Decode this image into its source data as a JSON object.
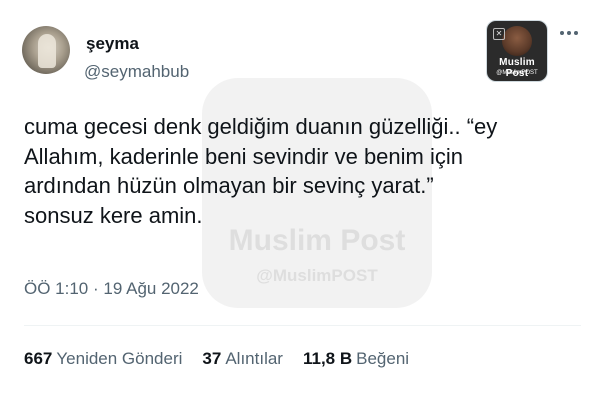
{
  "author": {
    "name": "şeyma",
    "handle": "@seymahbub"
  },
  "badge": {
    "icon": "x-icon",
    "title": "Muslim Post",
    "subtitle": "@MuslimPOST"
  },
  "watermark": {
    "title": "Muslim Post",
    "subtitle": "@MuslimPOST"
  },
  "tweet": {
    "lines": [
      "cuma gecesi denk geldiğim duanın güzelliği.. “ey",
      "Allahım, kaderinle beni sevindir ve benim için",
      "ardından hüzün olmayan bir sevinç yarat.”",
      "sonsuz kere amin."
    ]
  },
  "meta": {
    "time": "ÖÖ 1:10",
    "separator": "·",
    "date": "19 Ağu 2022"
  },
  "stats": {
    "retweets": {
      "value": "667",
      "label": "Yeniden Gönderi"
    },
    "quotes": {
      "value": "37",
      "label": "Alıntılar"
    },
    "likes": {
      "value": "11,8 B",
      "label": "Beğeni"
    }
  },
  "colors": {
    "text": "#0f1419",
    "secondary": "#536471",
    "divider": "#eff3f4"
  }
}
